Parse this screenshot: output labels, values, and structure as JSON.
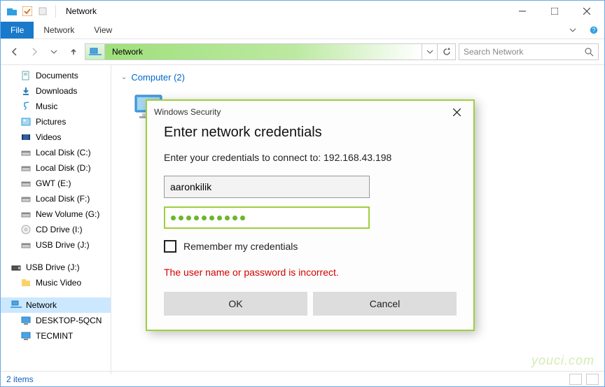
{
  "window": {
    "title": "Network"
  },
  "menu": {
    "file": "File",
    "network": "Network",
    "view": "View"
  },
  "address": {
    "crumb": "Network"
  },
  "search": {
    "placeholder": "Search Network"
  },
  "sidebar": {
    "items": [
      {
        "label": "Documents"
      },
      {
        "label": "Downloads"
      },
      {
        "label": "Music"
      },
      {
        "label": "Pictures"
      },
      {
        "label": "Videos"
      },
      {
        "label": "Local Disk (C:)"
      },
      {
        "label": "Local Disk (D:)"
      },
      {
        "label": "GWT (E:)"
      },
      {
        "label": "Local Disk (F:)"
      },
      {
        "label": "New Volume (G:)"
      },
      {
        "label": "CD Drive (I:)"
      },
      {
        "label": "USB Drive (J:)"
      }
    ],
    "group2": [
      {
        "label": "USB Drive (J:)"
      },
      {
        "label": "Music Video"
      }
    ],
    "network": {
      "label": "Network",
      "children": [
        {
          "label": "DESKTOP-5QCN"
        },
        {
          "label": "TECMINT"
        }
      ]
    }
  },
  "content": {
    "section": "Computer (2)"
  },
  "dialog": {
    "title": "Windows Security",
    "heading": "Enter network credentials",
    "subtitle": "Enter your credentials to connect to: 192.168.43.198",
    "username": "aaronkilik",
    "password_dots": 10,
    "remember": "Remember my credentials",
    "error": "The user name or password is incorrect.",
    "ok": "OK",
    "cancel": "Cancel"
  },
  "status": {
    "text": "2 items"
  },
  "watermark": "youci.com"
}
